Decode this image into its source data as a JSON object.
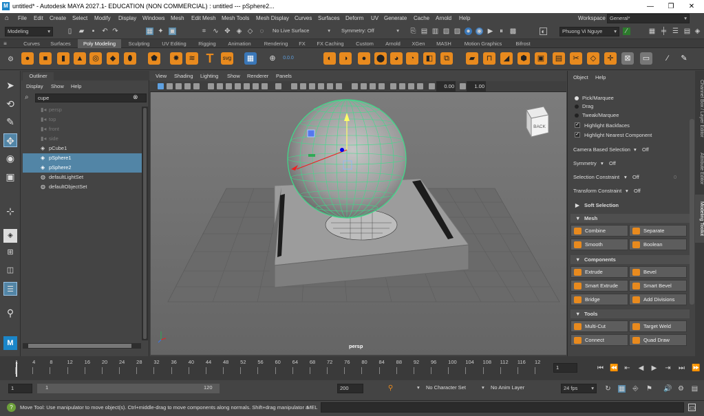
{
  "titlebar": {
    "app_icon": "M",
    "title": "untitled* - Autodesk MAYA 2027.1- EDUCATION (NON COMMERCIAL) : untitled   ---   pSphere2...",
    "minimize": "—",
    "maximize": "❐",
    "close": "✕"
  },
  "menubar": {
    "items": [
      "File",
      "Edit",
      "Create",
      "Select",
      "Modify",
      "Display",
      "Windows",
      "Mesh",
      "Edit Mesh",
      "Mesh Tools",
      "Mesh Display",
      "Curves",
      "Surfaces",
      "Deform",
      "UV",
      "Generate",
      "Cache",
      "Arnold",
      "Help"
    ],
    "workspace_label": "Workspace :",
    "workspace_value": "General*"
  },
  "statusline": {
    "menuset": "Modeling",
    "live_surface": "No Live Surface",
    "symmetry": "Symmetry: Off",
    "user": "Phuong Vi Nguye"
  },
  "shelf": {
    "tabs": [
      "Curves",
      "Surfaces",
      "Poly Modeling",
      "Sculpting",
      "UV Editing",
      "Rigging",
      "Animation",
      "Rendering",
      "FX",
      "FX Caching",
      "Custom",
      "Arnold",
      "XGen",
      "MASH",
      "Motion Graphics",
      "Bifrost"
    ],
    "active_tab": "Poly Modeling",
    "svg_label": "svg",
    "text_icon": "T",
    "counter_label": "0.0.0"
  },
  "outliner": {
    "tab": "Outliner",
    "menu": [
      "Display",
      "Show",
      "Help"
    ],
    "search_value": "cupe",
    "items": [
      {
        "label": "persp",
        "state": "dim"
      },
      {
        "label": "top",
        "state": "dim"
      },
      {
        "label": "front",
        "state": "dim"
      },
      {
        "label": "side",
        "state": "dim"
      },
      {
        "label": "pCube1",
        "state": "normal"
      },
      {
        "label": "pSphere1",
        "state": "selected"
      },
      {
        "label": "pSphere2",
        "state": "selected"
      },
      {
        "label": "defaultLightSet",
        "state": "normal"
      },
      {
        "label": "defaultObjectSet",
        "state": "normal"
      }
    ]
  },
  "viewport": {
    "menu": [
      "View",
      "Shading",
      "Lighting",
      "Show",
      "Renderer",
      "Panels"
    ],
    "exposure": "0.00",
    "gamma": "1.00",
    "camera_label": "persp",
    "viewcube_label": "BACK"
  },
  "modeling_toolkit": {
    "menu": [
      "Object",
      "Help"
    ],
    "select_modes": [
      {
        "label": "Pick/Marquee",
        "on": true
      },
      {
        "label": "Drag",
        "on": false
      },
      {
        "label": "Tweak/Marquee",
        "on": false
      }
    ],
    "checks": [
      {
        "label": "Highlight Backfaces",
        "checked": true
      },
      {
        "label": "Highlight Nearest Component",
        "checked": true
      }
    ],
    "camera_selection": "Camera Based Selection",
    "camera_selection_value": "Off",
    "symmetry": "Symmetry",
    "symmetry_value": "Off",
    "selection_constraint": "Selection Constraint",
    "selection_constraint_value": "Off",
    "selection_constraint_num": "0",
    "transform_constraint": "Transform Constraint",
    "transform_constraint_value": "Off",
    "soft_selection": "Soft Selection",
    "sections": [
      {
        "title": "Mesh",
        "buttons": [
          "Combine",
          "Separate",
          "Smooth",
          "Boolean"
        ]
      },
      {
        "title": "Components",
        "buttons": [
          "Extrude",
          "Bevel",
          "Smart Extrude",
          "Smart Bevel",
          "Bridge",
          "Add Divisions"
        ]
      },
      {
        "title": "Tools",
        "buttons": [
          "Multi-Cut",
          "Target Weld",
          "Connect",
          "Quad Draw"
        ]
      }
    ],
    "side_tabs": [
      "Channel Box / Layer Editor",
      "Attribute Editor",
      "Modeling Toolkit"
    ]
  },
  "timeline": {
    "ticks": [
      "1",
      "4",
      "8",
      "12",
      "16",
      "20",
      "24",
      "28",
      "32",
      "36",
      "40",
      "44",
      "48",
      "52",
      "56",
      "60",
      "64",
      "68",
      "72",
      "76",
      "80",
      "84",
      "88",
      "92",
      "96",
      "100",
      "104",
      "108",
      "112",
      "116",
      "12"
    ],
    "current_frame": "1"
  },
  "range": {
    "start": "1",
    "inner_start": "1",
    "inner_end": "120",
    "end": "200",
    "character_set": "No Character Set",
    "anim_layer": "No Anim Layer",
    "fps": "24 fps"
  },
  "cmdline": {
    "help_text": "Move Tool: Use manipulator to move object(s). Ctrl+middle-drag to move components along normals. Shift+drag manipulator a",
    "mel_label": "MEL"
  },
  "colors": {
    "selection": "#5285a6",
    "shelf_orange": "#e88a1e",
    "wire_green": "#3ddc8a"
  }
}
